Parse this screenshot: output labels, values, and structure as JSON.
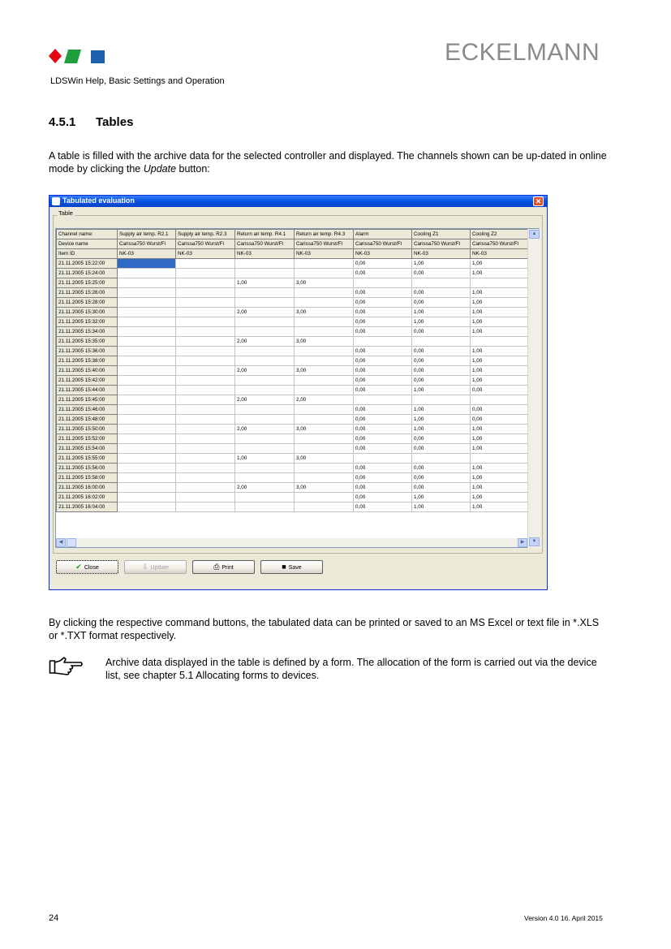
{
  "header": {
    "brand": "ECKELMANN",
    "subtitle": "LDSWin Help, Basic Settings and Operation",
    "logo_colors": [
      "#e30613",
      "#1fa03c",
      "#1f5fb0"
    ]
  },
  "section": {
    "number": "4.5.1",
    "title": "Tables"
  },
  "intro": {
    "before": "A table is filled with the archive data for the selected controller and displayed. The channels shown can be up-dated in online mode by clicking the ",
    "emphasis": "Update",
    "after": " button:"
  },
  "window": {
    "title": "Tabulated evaluation",
    "close_glyph": "✕",
    "group_label": "Table",
    "header_rows": [
      [
        "Channel name:",
        "Supply air temp. R2.1",
        "Supply air temp. R2.3",
        "Return air temp. R4.1",
        "Return air temp. R4.3",
        "Alarm",
        "Cooling Z1",
        "Cooling Z2"
      ],
      [
        "Device name",
        "Carissa750 Wurst/Fl",
        "Carissa750 Wurst/Fl",
        "Carissa750 Wurst/Fl",
        "Carissa750 Wurst/Fl",
        "Carissa750 Wurst/Fl",
        "Carissa750 Wurst/Fl",
        "Carissa750 Wurst/Fl"
      ],
      [
        "Item ID",
        "NK-03",
        "NK-03",
        "NK-03",
        "NK-03",
        "NK-03",
        "NK-03",
        "NK-03"
      ]
    ],
    "rows": [
      [
        "21.11.2005 15:22:00",
        "",
        "",
        "",
        "",
        "0,00",
        "1,00",
        "1,00"
      ],
      [
        "21.11.2005 15:24:00",
        "",
        "",
        "",
        "",
        "0,00",
        "0,00",
        "1,00"
      ],
      [
        "21.11.2005 15:25:00",
        "",
        "",
        "1,00",
        "3,00",
        "",
        "",
        ""
      ],
      [
        "21.11.2005 15:26:00",
        "",
        "",
        "",
        "",
        "0,00",
        "0,00",
        "1,00"
      ],
      [
        "21.11.2005 15:28:00",
        "",
        "",
        "",
        "",
        "0,00",
        "0,00",
        "1,00"
      ],
      [
        "21.11.2005 15:30:00",
        "",
        "",
        "2,00",
        "3,00",
        "0,00",
        "1,00",
        "1,00"
      ],
      [
        "21.11.2005 15:32:00",
        "",
        "",
        "",
        "",
        "0,00",
        "1,00",
        "1,00"
      ],
      [
        "21.11.2005 15:34:00",
        "",
        "",
        "",
        "",
        "0,00",
        "0,00",
        "1,00"
      ],
      [
        "21.11.2005 15:35:00",
        "",
        "",
        "2,00",
        "3,00",
        "",
        "",
        ""
      ],
      [
        "21.11.2005 15:36:00",
        "",
        "",
        "",
        "",
        "0,00",
        "0,00",
        "1,00"
      ],
      [
        "21.11.2005 15:38:00",
        "",
        "",
        "",
        "",
        "0,00",
        "0,00",
        "1,00"
      ],
      [
        "21.11.2005 15:40:00",
        "",
        "",
        "2,00",
        "3,00",
        "0,00",
        "0,00",
        "1,00"
      ],
      [
        "21.11.2005 15:42:00",
        "",
        "",
        "",
        "",
        "0,00",
        "0,00",
        "1,00"
      ],
      [
        "21.11.2005 15:44:00",
        "",
        "",
        "",
        "",
        "0,00",
        "1,00",
        "0,00"
      ],
      [
        "21.11.2005 15:45:00",
        "",
        "",
        "2,00",
        "2,00",
        "",
        "",
        ""
      ],
      [
        "21.11.2005 15:46:00",
        "",
        "",
        "",
        "",
        "0,00",
        "1,00",
        "0,00"
      ],
      [
        "21.11.2005 15:48:00",
        "",
        "",
        "",
        "",
        "0,00",
        "1,00",
        "0,00"
      ],
      [
        "21.11.2005 15:50:00",
        "",
        "",
        "2,00",
        "3,00",
        "0,00",
        "1,00",
        "1,00"
      ],
      [
        "21.11.2005 15:52:00",
        "",
        "",
        "",
        "",
        "0,00",
        "0,00",
        "1,00"
      ],
      [
        "21.11.2005 15:54:00",
        "",
        "",
        "",
        "",
        "0,00",
        "0,00",
        "1,00"
      ],
      [
        "21.11.2005 15:55:00",
        "",
        "",
        "1,00",
        "3,00",
        "",
        "",
        ""
      ],
      [
        "21.11.2005 15:56:00",
        "",
        "",
        "",
        "",
        "0,00",
        "0,00",
        "1,00"
      ],
      [
        "21.11.2005 15:58:00",
        "",
        "",
        "",
        "",
        "0,00",
        "0,00",
        "1,00"
      ],
      [
        "21.11.2005 16:00:00",
        "",
        "",
        "2,00",
        "3,00",
        "0,00",
        "0,00",
        "1,00"
      ],
      [
        "21.11.2005 16:02:00",
        "",
        "",
        "",
        "",
        "0,00",
        "1,00",
        "1,00"
      ],
      [
        "21.11.2005 16:04:00",
        "",
        "",
        "",
        "",
        "0,00",
        "1,00",
        "1,00"
      ]
    ],
    "buttons": {
      "close": "Close",
      "update": "Update",
      "print": "Print",
      "save": "Save"
    },
    "icons": {
      "close": "checkmark-icon",
      "update": "update-icon",
      "print": "printer-icon",
      "save": "floppy-disk-icon"
    }
  },
  "paragraph2": "By clicking the respective command buttons, the tabulated data can be printed or saved to an MS Excel or text file in *.XLS or *.TXT format respectively.",
  "note": "Archive data displayed in the table is defined by a form. The allocation of the form is carried out via the device list, see chapter 5.1 Allocating forms to devices.",
  "footer": {
    "page": "24",
    "version": "Version 4.0   16. April 2015"
  }
}
